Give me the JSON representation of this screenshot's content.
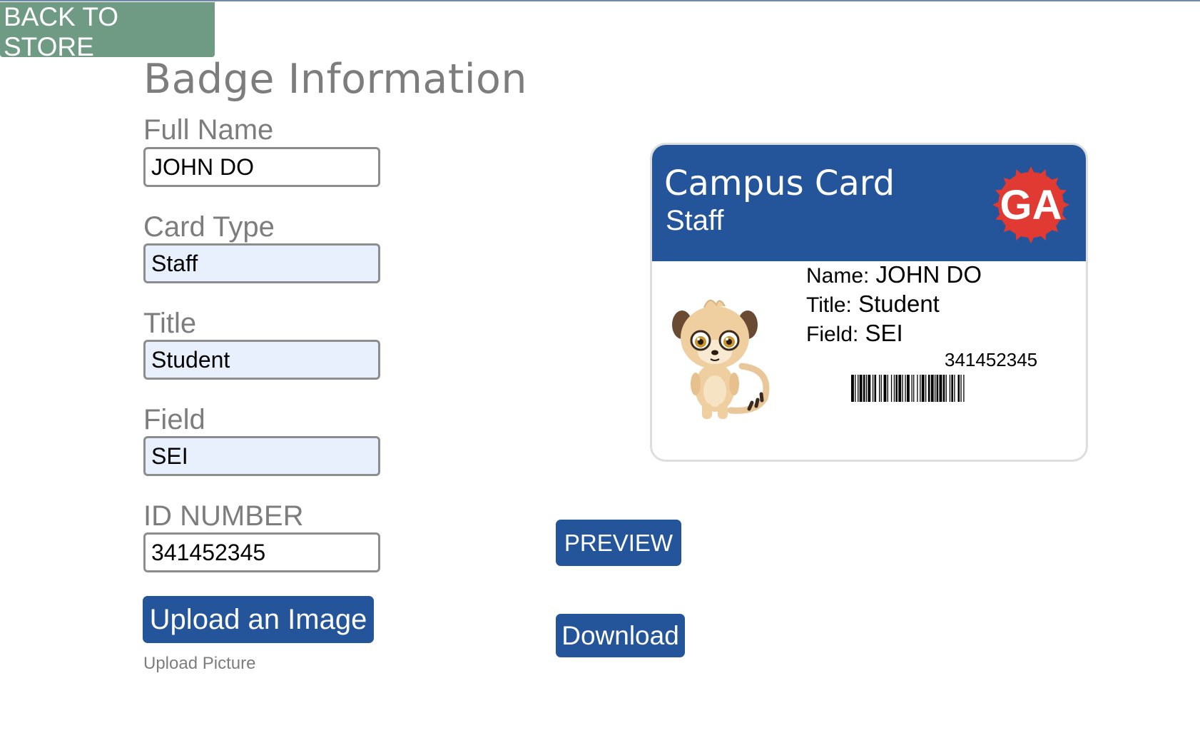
{
  "nav": {
    "back_label": "BACK TO STORE"
  },
  "form": {
    "title": "Badge Information",
    "fields": [
      {
        "label": "Full Name",
        "value": "JOHN DO"
      },
      {
        "label": "Card Type",
        "value": "Staff"
      },
      {
        "label": "Title",
        "value": "Student"
      },
      {
        "label": "Field",
        "value": "SEI"
      },
      {
        "label": "ID NUMBER",
        "value": "341452345"
      }
    ],
    "upload_label": "Upload an Image",
    "upload_caption": "Upload Picture"
  },
  "actions": {
    "preview_label": "PREVIEW",
    "download_label": "Download"
  },
  "card": {
    "title": "Campus Card",
    "type": "Staff",
    "logo_text": "GA",
    "name_key": "Name:",
    "name_value": "JOHN DO",
    "title_key": "Title:",
    "title_value": "Student",
    "field_key": "Field:",
    "field_value": "SEI",
    "id_number": "341452345"
  },
  "colors": {
    "primary_blue": "#24549a",
    "back_green": "#6f9b85",
    "label_gray": "#7d7d7d",
    "logo_red": "#e03a32"
  }
}
